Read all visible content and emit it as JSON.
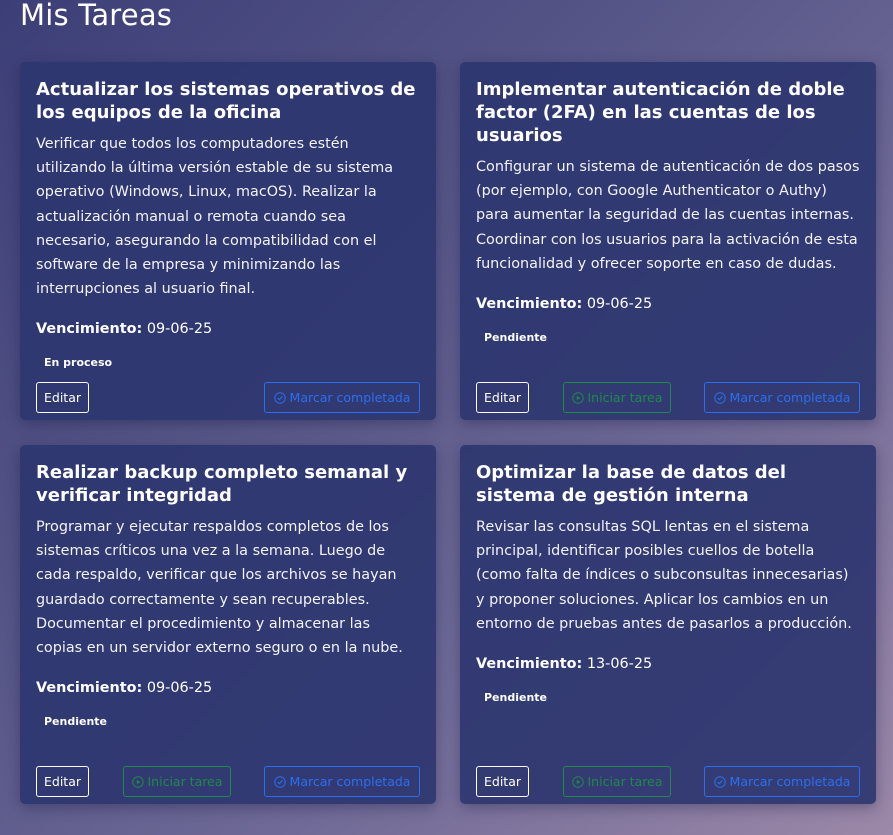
{
  "page": {
    "title": "Mis Tareas"
  },
  "labels": {
    "due_label": "Vencimiento:",
    "edit": "Editar",
    "start": "Iniciar tarea",
    "complete": "Marcar completada"
  },
  "colors": {
    "start_accent": "#1f8a4a",
    "complete_accent": "#2b6ff0"
  },
  "icons": {
    "start": "play-circle-icon",
    "complete": "check-circle-icon"
  },
  "tasks": [
    {
      "title": "Actualizar los sistemas operativos de los equipos de la oficina",
      "description": "Verificar que todos los computadores estén utilizando la última versión estable de su sistema operativo (Windows, Linux, macOS). Realizar la actualización manual o remota cuando sea necesario, asegurando la compatibilidad con el software de la empresa y minimizando las interrupciones al usuario final.",
      "due": "09-06-25",
      "status": "En proceso"
    },
    {
      "title": "Implementar autenticación de doble factor (2FA) en las cuentas de los usuarios",
      "description": "Configurar un sistema de autenticación de dos pasos (por ejemplo, con Google Authenticator o Authy) para aumentar la seguridad de las cuentas internas. Coordinar con los usuarios para la activación de esta funcionalidad y ofrecer soporte en caso de dudas.",
      "due": "09-06-25",
      "status": "Pendiente"
    },
    {
      "title": "Realizar backup completo semanal y verificar integridad",
      "description": "Programar y ejecutar respaldos completos de los sistemas críticos una vez a la semana. Luego de cada respaldo, verificar que los archivos se hayan guardado correctamente y sean recuperables. Documentar el procedimiento y almacenar las copias en un servidor externo seguro o en la nube.",
      "due": "09-06-25",
      "status": "Pendiente"
    },
    {
      "title": "Optimizar la base de datos del sistema de gestión interna",
      "description": "Revisar las consultas SQL lentas en el sistema principal, identificar posibles cuellos de botella (como falta de índices o subconsultas innecesarias) y proponer soluciones. Aplicar los cambios en un entorno de pruebas antes de pasarlos a producción.",
      "due": "13-06-25",
      "status": "Pendiente"
    }
  ]
}
